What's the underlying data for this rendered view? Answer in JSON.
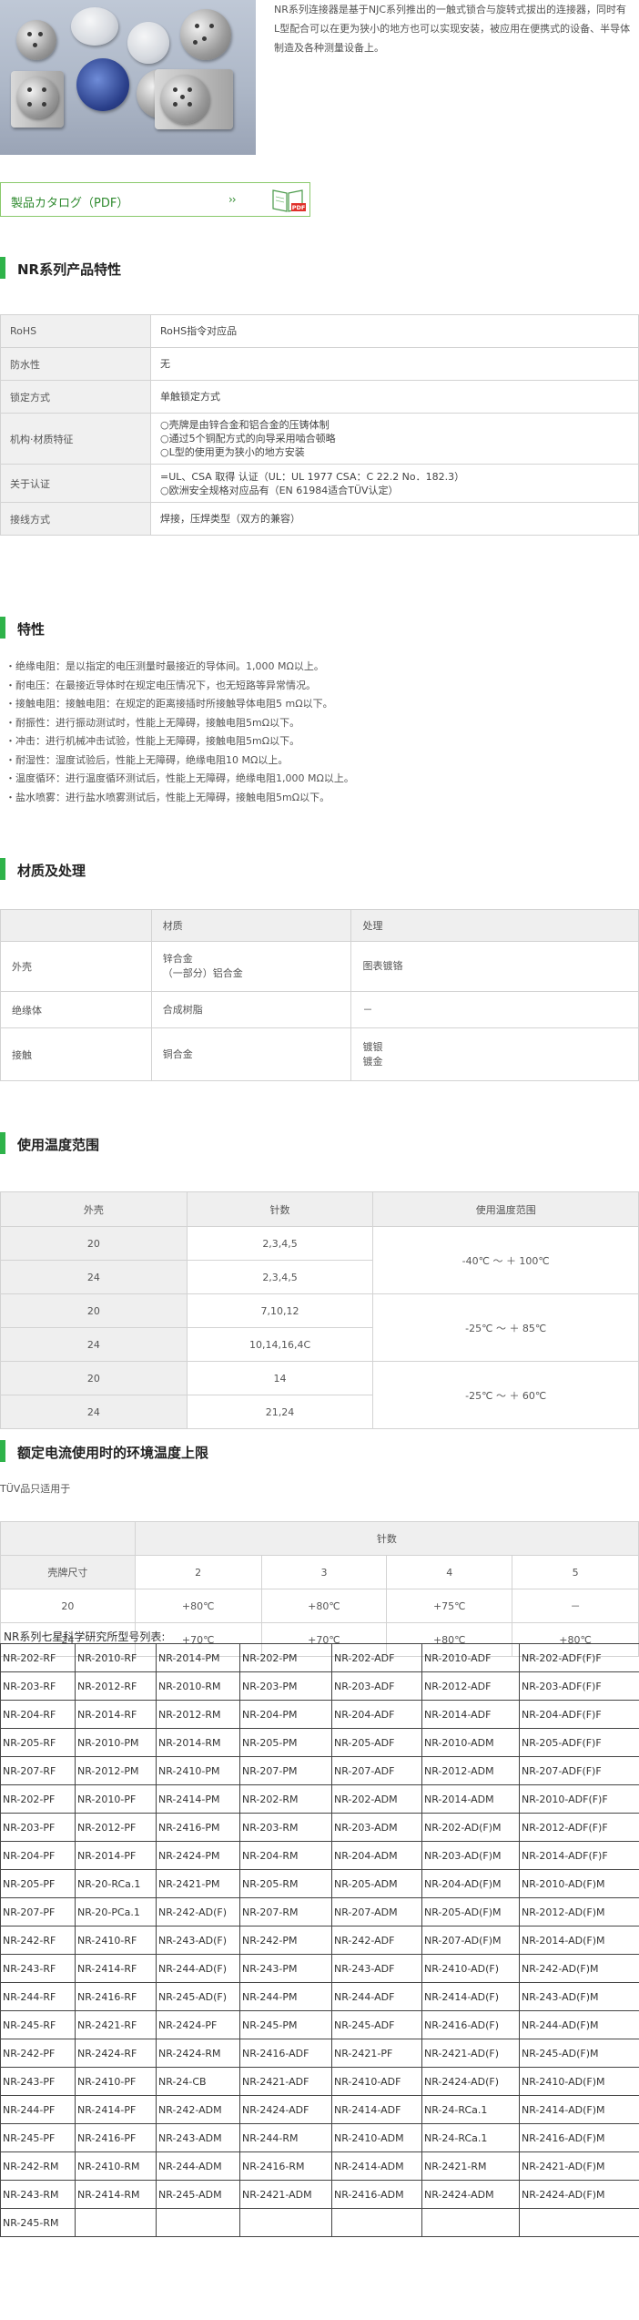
{
  "intro": "NR系列连接器是基于NJC系列推出的一触式锁合与旋转式拔出的连接器，同时有L型配合可以在更为狭小的地方也可以实现安装，被应用在便携式的设备、半导体制造及各种测量设备上。",
  "catalog": {
    "label": "製品カタログ（PDF）",
    "arrow": "››",
    "pdf_badge": "PDF"
  },
  "sec_features": {
    "title": "NR系列产品特性"
  },
  "spec_rows": [
    {
      "k": "RoHS",
      "v": [
        "RoHS指令对应品"
      ]
    },
    {
      "k": "防水性",
      "v": [
        "无"
      ]
    },
    {
      "k": "锁定方式",
      "v": [
        "单触锁定方式"
      ]
    },
    {
      "k": "机构·材质特征",
      "v": [
        "○壳牌是由锌合金和铝合金的压铸体制",
        "○通过5个铜配方式的向导采用啮合顿略",
        "○L型的使用更为狭小的地方安装"
      ]
    },
    {
      "k": "关于认证",
      "v": [
        "=UL、CSA 取得 认证（UL：UL 1977 CSA：C 22.2 No．182.3）",
        "○欧洲安全规格对应品有（EN 61984适合TÜV认定）"
      ]
    },
    {
      "k": "接线方式",
      "v": [
        "焊接，压焊类型（双方的兼容）"
      ]
    }
  ],
  "sec_char": {
    "title": "特性"
  },
  "characteristics": [
    "・绝缘电阻：是以指定的电压测量时最接近的导体间。1,000 MΩ以上。",
    "・耐电压：在最接近导体时在规定电压情况下，也无短路等异常情况。",
    "・接触电阻：接触电阻：在规定的距离接插时所接触导体电阻5 mΩ以下。",
    "・耐振性：进行振动测试时，性能上无障碍，接触电阻5mΩ以下。",
    "・冲击：进行机械冲击试验，性能上无障碍，接触电阻5mΩ以下。",
    "・耐湿性：湿度试验后，性能上无障碍，绝缘电阻10 MΩ以上。",
    "・温度循环：进行温度循环测试后，性能上无障碍，绝缘电阻1,000 MΩ以上。",
    "・盐水喷雾：进行盐水喷雾测试后，性能上无障碍，接触电阻5mΩ以下。"
  ],
  "sec_mat": {
    "title": "材质及处理"
  },
  "material": {
    "headers": [
      "",
      "材质",
      "处理"
    ],
    "rows": [
      {
        "part": "外壳",
        "mat": [
          "锌合金",
          "（一部分）铝合金"
        ],
        "treat": [
          "图表镀铬"
        ]
      },
      {
        "part": "绝缘体",
        "mat": [
          "合成树脂"
        ],
        "treat": [
          "－"
        ]
      },
      {
        "part": "接触",
        "mat": [
          "铜合金"
        ],
        "treat": [
          "镀银",
          "镀金"
        ]
      }
    ]
  },
  "sec_temp": {
    "title": "使用温度范围"
  },
  "temp": {
    "headers": [
      "外壳",
      "针数",
      "使用温度范围"
    ],
    "rows": [
      [
        "20",
        "2,3,4,5"
      ],
      [
        "24",
        "2,3,4,5"
      ],
      [
        "20",
        "7,10,12"
      ],
      [
        "24",
        "10,14,16,4C"
      ],
      [
        "20",
        "14"
      ],
      [
        "24",
        "21,24"
      ]
    ],
    "ranges": [
      "-40℃ ～ ＋ 100℃",
      "-25℃ ～ ＋ 85℃",
      "-25℃ ～ ＋ 60℃"
    ]
  },
  "sec_env": {
    "title": "额定电流使用时的环境温度上限"
  },
  "env_note": "TÜV品只适用于",
  "env": {
    "pins_header": "针数",
    "size_header": "壳牌尺寸",
    "pins": [
      "2",
      "3",
      "4",
      "5"
    ],
    "rows": [
      {
        "size": "20",
        "vals": [
          "+80℃",
          "+80℃",
          "+75℃",
          "－"
        ]
      },
      {
        "size": "24",
        "vals": [
          "+70℃",
          "+70℃",
          "+80℃",
          "+80℃"
        ]
      }
    ]
  },
  "model_list": {
    "title": " NR系列七星科学研究所型号列表:",
    "rows": [
      [
        "NR-202-RF",
        "NR-2010-RF",
        "NR-2014-PM",
        "NR-202-PM",
        "NR-202-ADF",
        "NR-2010-ADF",
        "NR-202-ADF(F)F"
      ],
      [
        "NR-203-RF",
        "NR-2012-RF",
        "NR-2010-RM",
        "NR-203-PM",
        "NR-203-ADF",
        "NR-2012-ADF",
        "NR-203-ADF(F)F"
      ],
      [
        "NR-204-RF",
        "NR-2014-RF",
        "NR-2012-RM",
        "NR-204-PM",
        "NR-204-ADF",
        "NR-2014-ADF",
        "NR-204-ADF(F)F"
      ],
      [
        "NR-205-RF",
        "NR-2010-PM",
        "NR-2014-RM",
        "NR-205-PM",
        "NR-205-ADF",
        "NR-2010-ADM",
        "NR-205-ADF(F)F"
      ],
      [
        "NR-207-RF",
        "NR-2012-PM",
        "NR-2410-PM",
        "NR-207-PM",
        "NR-207-ADF",
        "NR-2012-ADM",
        "NR-207-ADF(F)F"
      ],
      [
        "NR-202-PF",
        "NR-2010-PF",
        "NR-2414-PM",
        "NR-202-RM",
        "NR-202-ADM",
        "NR-2014-ADM",
        "NR-2010-ADF(F)F"
      ],
      [
        "NR-203-PF",
        "NR-2012-PF",
        "NR-2416-PM",
        "NR-203-RM",
        "NR-203-ADM",
        "NR-202-AD(F)M",
        "NR-2012-ADF(F)F"
      ],
      [
        "NR-204-PF",
        "NR-2014-PF",
        "NR-2424-PM",
        "NR-204-RM",
        "NR-204-ADM",
        "NR-203-AD(F)M",
        "NR-2014-ADF(F)F"
      ],
      [
        "NR-205-PF",
        "NR-20-RCa.1",
        "NR-2421-PM",
        "NR-205-RM",
        "NR-205-ADM",
        "NR-204-AD(F)M",
        "NR-2010-AD(F)M"
      ],
      [
        "NR-207-PF",
        "NR-20-PCa.1",
        "NR-242-AD(F)",
        "NR-207-RM",
        "NR-207-ADM",
        "NR-205-AD(F)M",
        "NR-2012-AD(F)M"
      ],
      [
        "NR-242-RF",
        "NR-2410-RF",
        "NR-243-AD(F)",
        "NR-242-PM",
        "NR-242-ADF",
        "NR-207-AD(F)M",
        "NR-2014-AD(F)M"
      ],
      [
        "NR-243-RF",
        "NR-2414-RF",
        "NR-244-AD(F)",
        "NR-243-PM",
        "NR-243-ADF",
        "NR-2410-AD(F)",
        "NR-242-AD(F)M"
      ],
      [
        "NR-244-RF",
        "NR-2416-RF",
        "NR-245-AD(F)",
        "NR-244-PM",
        "NR-244-ADF",
        "NR-2414-AD(F)",
        "NR-243-AD(F)M"
      ],
      [
        "NR-245-RF",
        "NR-2421-RF",
        "NR-2424-PF",
        "NR-245-PM",
        "NR-245-ADF",
        "NR-2416-AD(F)",
        "NR-244-AD(F)M"
      ],
      [
        "NR-242-PF",
        "NR-2424-RF",
        "NR-2424-RM",
        "NR-2416-ADF",
        "NR-2421-PF",
        "NR-2421-AD(F)",
        "NR-245-AD(F)M"
      ],
      [
        "NR-243-PF",
        "NR-2410-PF",
        "NR-24-CB",
        "NR-2421-ADF",
        "NR-2410-ADF",
        "NR-2424-AD(F)",
        "NR-2410-AD(F)M"
      ],
      [
        "NR-244-PF",
        "NR-2414-PF",
        "NR-242-ADM",
        "NR-2424-ADF",
        "NR-2414-ADF",
        "NR-24-RCa.1",
        "NR-2414-AD(F)M"
      ],
      [
        "NR-245-PF",
        "NR-2416-PF",
        "NR-243-ADM",
        "NR-244-RM",
        "NR-2410-ADM",
        "NR-24-RCa.1",
        "NR-2416-AD(F)M"
      ],
      [
        "NR-242-RM",
        "NR-2410-RM",
        "NR-244-ADM",
        "NR-2416-RM",
        "NR-2414-ADM",
        "NR-2421-RM",
        "NR-2421-AD(F)M"
      ],
      [
        "NR-243-RM",
        "NR-2414-RM",
        "NR-245-ADM",
        "NR-2421-ADM",
        "NR-2416-ADM",
        "NR-2424-ADM",
        "NR-2424-AD(F)M"
      ],
      [
        "NR-245-RM",
        "",
        "",
        "",
        "",
        "",
        ""
      ]
    ]
  }
}
